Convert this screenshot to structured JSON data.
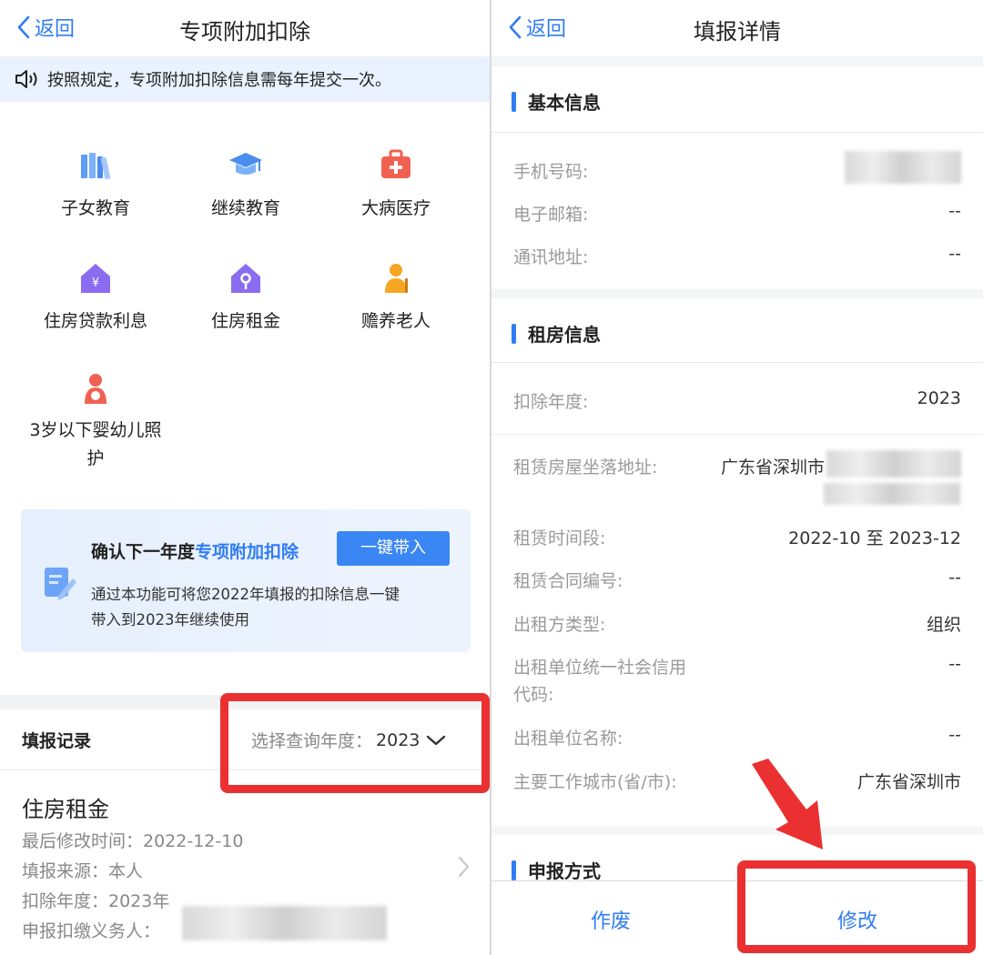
{
  "left": {
    "nav": {
      "back_label": "返回",
      "title": "专项附加扣除"
    },
    "notice": "按照规定，专项附加扣除信息需每年提交一次。",
    "categories": [
      {
        "label": "子女教育",
        "icon": "books-icon"
      },
      {
        "label": "继续教育",
        "icon": "graduation-cap-icon"
      },
      {
        "label": "大病医疗",
        "icon": "medical-kit-icon"
      },
      {
        "label": "住房贷款利息",
        "icon": "house-yuan-icon"
      },
      {
        "label": "住房租金",
        "icon": "house-key-icon"
      },
      {
        "label": "赡养老人",
        "icon": "elderly-icon"
      },
      {
        "label_line1": "3岁以下婴幼儿照",
        "label_line2": "护",
        "icon": "mother-baby-icon"
      }
    ],
    "promo": {
      "title_prefix": "确认下一年度",
      "title_highlight": "专项附加扣除",
      "button": "一键带入",
      "desc_line1": "通过本功能可将您2022年填报的扣除信息一键",
      "desc_line2": "带入到2023年继续使用"
    },
    "records": {
      "heading": "填报记录",
      "year_label": "选择查询年度：",
      "year_value": "2023",
      "item": {
        "title": "住房租金",
        "modified": "最后修改时间：2022-12-10",
        "source": "填报来源：本人",
        "year": "扣除年度：2023年",
        "withholder_label": "申报扣缴义务人："
      }
    }
  },
  "right": {
    "nav": {
      "back_label": "返回",
      "title": "填报详情"
    },
    "basic": {
      "title": "基本信息",
      "phone_label": "手机号码:",
      "email_label": "电子邮箱:",
      "email_value": "--",
      "address_label": "通讯地址:",
      "address_value": "--"
    },
    "rent": {
      "title": "租房信息",
      "year_label": "扣除年度:",
      "year_value": "2023",
      "location_label": "租赁房屋坐落地址:",
      "location_value": "广东省深圳市",
      "period_label": "租赁时间段:",
      "period_value": "2022-10 至 2023-12",
      "contract_label": "租赁合同编号:",
      "contract_value": "--",
      "lessor_type_label": "出租方类型:",
      "lessor_type_value": "组织",
      "credit_code_label_line1": "出租单位统一社会信用",
      "credit_code_label_line2": "代码:",
      "credit_code_value": "--",
      "lessor_name_label": "出租单位名称:",
      "lessor_name_value": "--",
      "work_city_label": "主要工作城市(省/市):",
      "work_city_value": "广东省深圳市"
    },
    "method": {
      "title": "申报方式"
    },
    "actions": {
      "void": "作废",
      "modify": "修改"
    }
  },
  "colors": {
    "accent": "#2f7cf6",
    "highlight_red": "#ea3030",
    "notice_bg": "#e9f2fe"
  }
}
